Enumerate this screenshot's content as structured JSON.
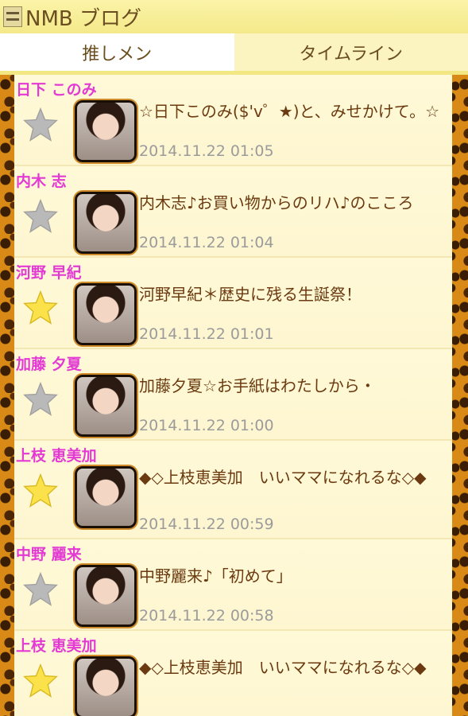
{
  "header": {
    "title": "NMB ブログ",
    "icon": "app-logo-icon"
  },
  "tabs": [
    {
      "label": "推しメン",
      "active": true
    },
    {
      "label": "タイムライン",
      "active": false
    }
  ],
  "items": [
    {
      "name": "日下 このみ",
      "title": "☆日下このみ($'v゜★)と、みせかけて。☆",
      "time": "2014.11.22 01:05",
      "favorite": false
    },
    {
      "name": "内木 志",
      "title": "内木志♪お買い物からのリハ♪のこころ",
      "time": "2014.11.22 01:04",
      "favorite": false
    },
    {
      "name": "河野 早紀",
      "title": "河野早紀＊歴史に残る生誕祭！",
      "time": "2014.11.22 01:01",
      "favorite": true
    },
    {
      "name": "加藤 夕夏",
      "title": "加藤夕夏☆お手紙はわたしから・",
      "time": "2014.11.22 01:00",
      "favorite": false
    },
    {
      "name": "上枝 恵美加",
      "title": "◆◇上枝恵美加　いいママになれるな◇◆",
      "time": "2014.11.22 00:59",
      "favorite": true
    },
    {
      "name": "中野 麗来",
      "title": "中野麗来♪「初めて」",
      "time": "2014.11.22 00:58",
      "favorite": false
    },
    {
      "name": "上枝 恵美加",
      "title": "◆◇上枝恵美加　いいママになれるな◇◆",
      "time": "",
      "favorite": true
    }
  ],
  "colors": {
    "accent_name": "#e23ad3",
    "header_bg": "#f4e98a",
    "star_on": "#fbe24a",
    "star_off": "#b9b9b9"
  }
}
